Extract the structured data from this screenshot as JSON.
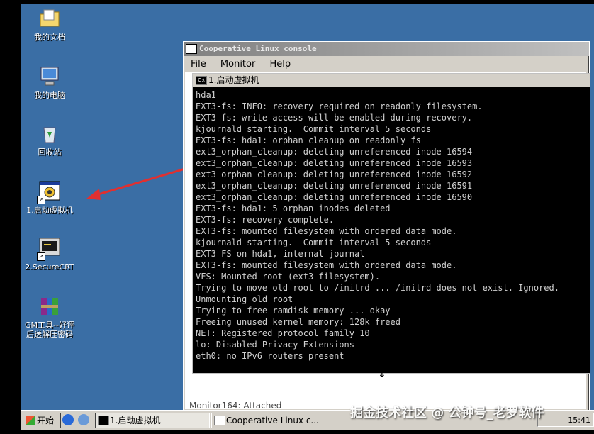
{
  "desktop": {
    "icons": [
      {
        "label": "我的文档",
        "icon": "folder-documents-icon"
      },
      {
        "label": "我的电脑",
        "icon": "computer-icon"
      },
      {
        "label": "回收站",
        "icon": "recycle-bin-icon"
      },
      {
        "label": "1.启动虚拟机",
        "icon": "vm-launcher-icon"
      },
      {
        "label": "2.SecureCRT",
        "icon": "securecrt-icon"
      },
      {
        "label": "GM工具--好评\n后送解压密码",
        "icon": "archive-icon"
      }
    ]
  },
  "coop_window": {
    "title": "Cooperative Linux console",
    "menu": [
      "File",
      "Monitor",
      "Help"
    ],
    "status": "Monitor164: Attached"
  },
  "console_window": {
    "title": "1.启动虚拟机",
    "lines": [
      "hda1",
      "EXT3-fs: INFO: recovery required on readonly filesystem.",
      "EXT3-fs: write access will be enabled during recovery.",
      "kjournald starting.  Commit interval 5 seconds",
      "EXT3-fs: hda1: orphan cleanup on readonly fs",
      "ext3_orphan_cleanup: deleting unreferenced inode 16594",
      "ext3_orphan_cleanup: deleting unreferenced inode 16593",
      "ext3_orphan_cleanup: deleting unreferenced inode 16592",
      "ext3_orphan_cleanup: deleting unreferenced inode 16591",
      "ext3_orphan_cleanup: deleting unreferenced inode 16590",
      "EXT3-fs: hda1: 5 orphan inodes deleted",
      "EXT3-fs: recovery complete.",
      "EXT3-fs: mounted filesystem with ordered data mode.",
      "kjournald starting.  Commit interval 5 seconds",
      "EXT3 FS on hda1, internal journal",
      "EXT3-fs: mounted filesystem with ordered data mode.",
      "VFS: Mounted root (ext3 filesystem).",
      "Trying to move old root to /initrd ... /initrd does not exist. Ignored.",
      "Unmounting old root",
      "Trying to free ramdisk memory ... okay",
      "Freeing unused kernel memory: 128k freed",
      "NET: Registered protocol family 10",
      "lo: Disabled Privacy Extensions",
      "eth0: no IPv6 routers present"
    ]
  },
  "taskbar": {
    "start_label": "开始",
    "tasks": [
      "1.启动虚拟机",
      "Cooperative Linux c..."
    ],
    "clock": "15:41"
  },
  "watermark": "掘金技术社区 @ 公钟号_老罗软件",
  "colors": {
    "desktop": "#3a6ea5",
    "taskbar": "#d4d0c8",
    "arrow": "#e03030"
  }
}
